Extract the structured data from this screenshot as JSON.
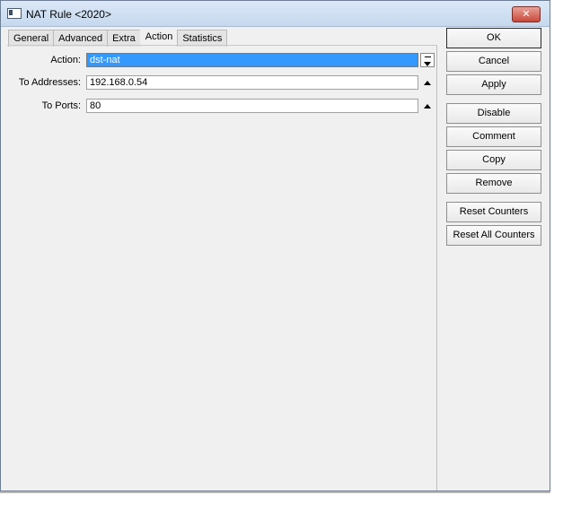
{
  "window": {
    "title": "NAT Rule <2020>",
    "close_label": "✕"
  },
  "tabs": [
    {
      "label": "General"
    },
    {
      "label": "Advanced"
    },
    {
      "label": "Extra"
    },
    {
      "label": "Action"
    },
    {
      "label": "Statistics"
    }
  ],
  "active_tab": "Action",
  "fields": {
    "action": {
      "label": "Action:",
      "value": "dst-nat"
    },
    "to_addresses": {
      "label": "To Addresses:",
      "value": "192.168.0.54"
    },
    "to_ports": {
      "label": "To Ports:",
      "value": "80"
    }
  },
  "buttons": {
    "ok": "OK",
    "cancel": "Cancel",
    "apply": "Apply",
    "disable": "Disable",
    "comment": "Comment",
    "copy": "Copy",
    "remove": "Remove",
    "reset_counters": "Reset Counters",
    "reset_all_counters": "Reset All Counters"
  },
  "colors": {
    "selection": "#3399ff",
    "close_button": "#c9493a"
  }
}
